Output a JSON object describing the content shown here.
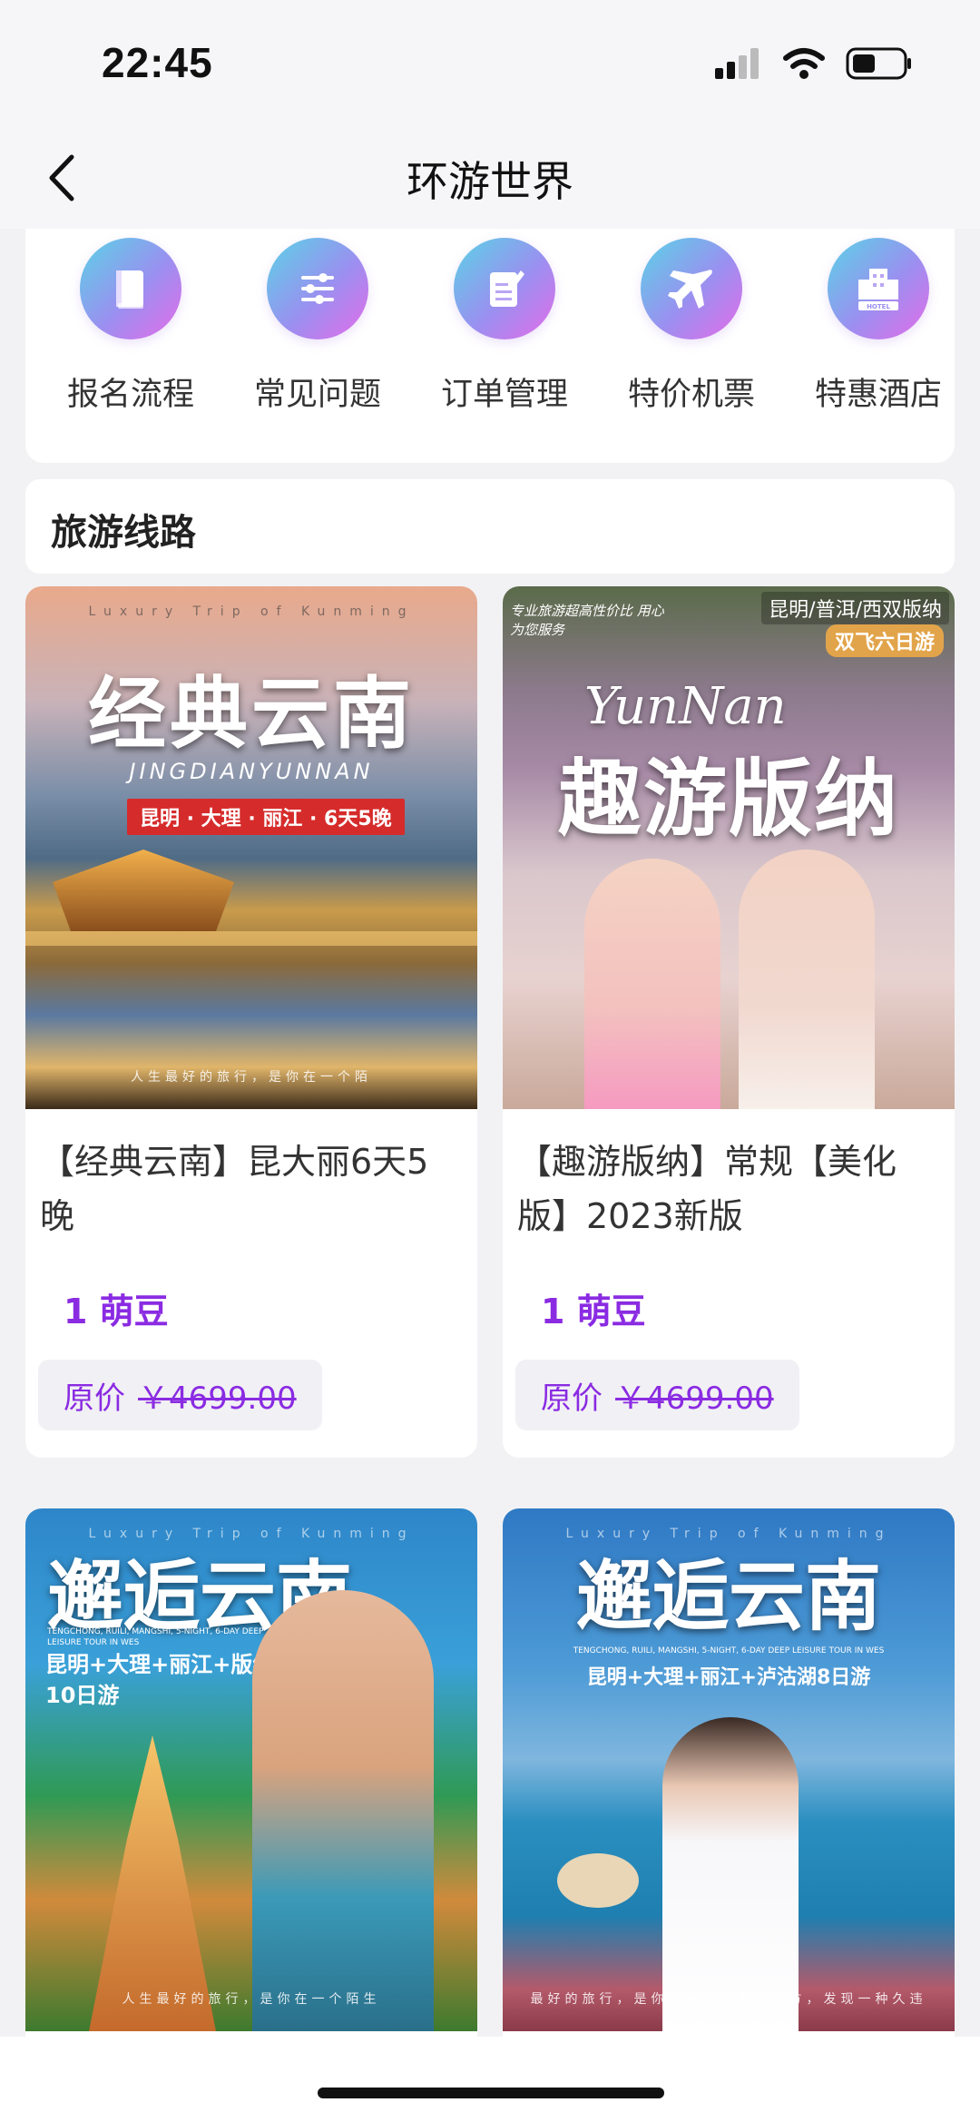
{
  "status_bar": {
    "time": "22:45"
  },
  "header": {
    "title": "环游世界"
  },
  "menu": {
    "items": [
      {
        "label": "报名流程",
        "icon": "book-icon"
      },
      {
        "label": "常见问题",
        "icon": "sliders-icon"
      },
      {
        "label": "订单管理",
        "icon": "document-edit-icon"
      },
      {
        "label": "特价机票",
        "icon": "airplane-icon"
      },
      {
        "label": "特惠酒店",
        "icon": "hotel-icon"
      }
    ]
  },
  "section": {
    "title": "旅游线路"
  },
  "products": [
    {
      "name": "【经典云南】昆大丽6天5晚",
      "price": "1 萌豆",
      "orig_label": "原价",
      "orig_price": "￥4699.00",
      "poster": {
        "tagline": "Luxury Trip of Kunming",
        "title": "经典云南",
        "pinyin": "JINGDIANYUNNAN",
        "route": "昆明 · 大理 · 丽江 · 6天5晚",
        "bottom": "人生最好的旅行，是你在一个陌"
      }
    },
    {
      "name": "【趣游版纳】常规【美化版】2023新版",
      "price": "1 萌豆",
      "orig_label": "原价",
      "orig_price": "￥4699.00",
      "poster": {
        "corner": "昆明/普洱/西双版纳",
        "badge": "双飞六日游",
        "script": "YunNan",
        "slogan": "专业旅游超高性价比 用心为您服务",
        "title": "趣游版纳"
      }
    },
    {
      "poster": {
        "tagline": "Luxury Trip of Kunming",
        "title": "邂逅云南",
        "subline": "TENGCHONG, RUILI, MANGSHI, 5-NIGHT, 6-DAY DEEP LEISURE TOUR IN WES",
        "route": "昆明+大理+丽江+版纳",
        "days": "10日游",
        "bottom": "人生最好的旅行，是你在一个陌生"
      }
    },
    {
      "poster": {
        "tagline": "Luxury Trip of Kunming",
        "title": "邂逅云南",
        "subline": "TENGCHONG, RUILI, MANGSHI, 5-NIGHT, 6-DAY DEEP LEISURE TOUR IN WES",
        "route": "昆明+大理+丽江+泸沽湖8日游",
        "bottom": "最好的旅行，是你在一个陌生的地方，发现一种久违"
      }
    }
  ],
  "colors": {
    "accent": "#8a2be2",
    "background": "#f2f2f4",
    "card": "#ffffff"
  }
}
